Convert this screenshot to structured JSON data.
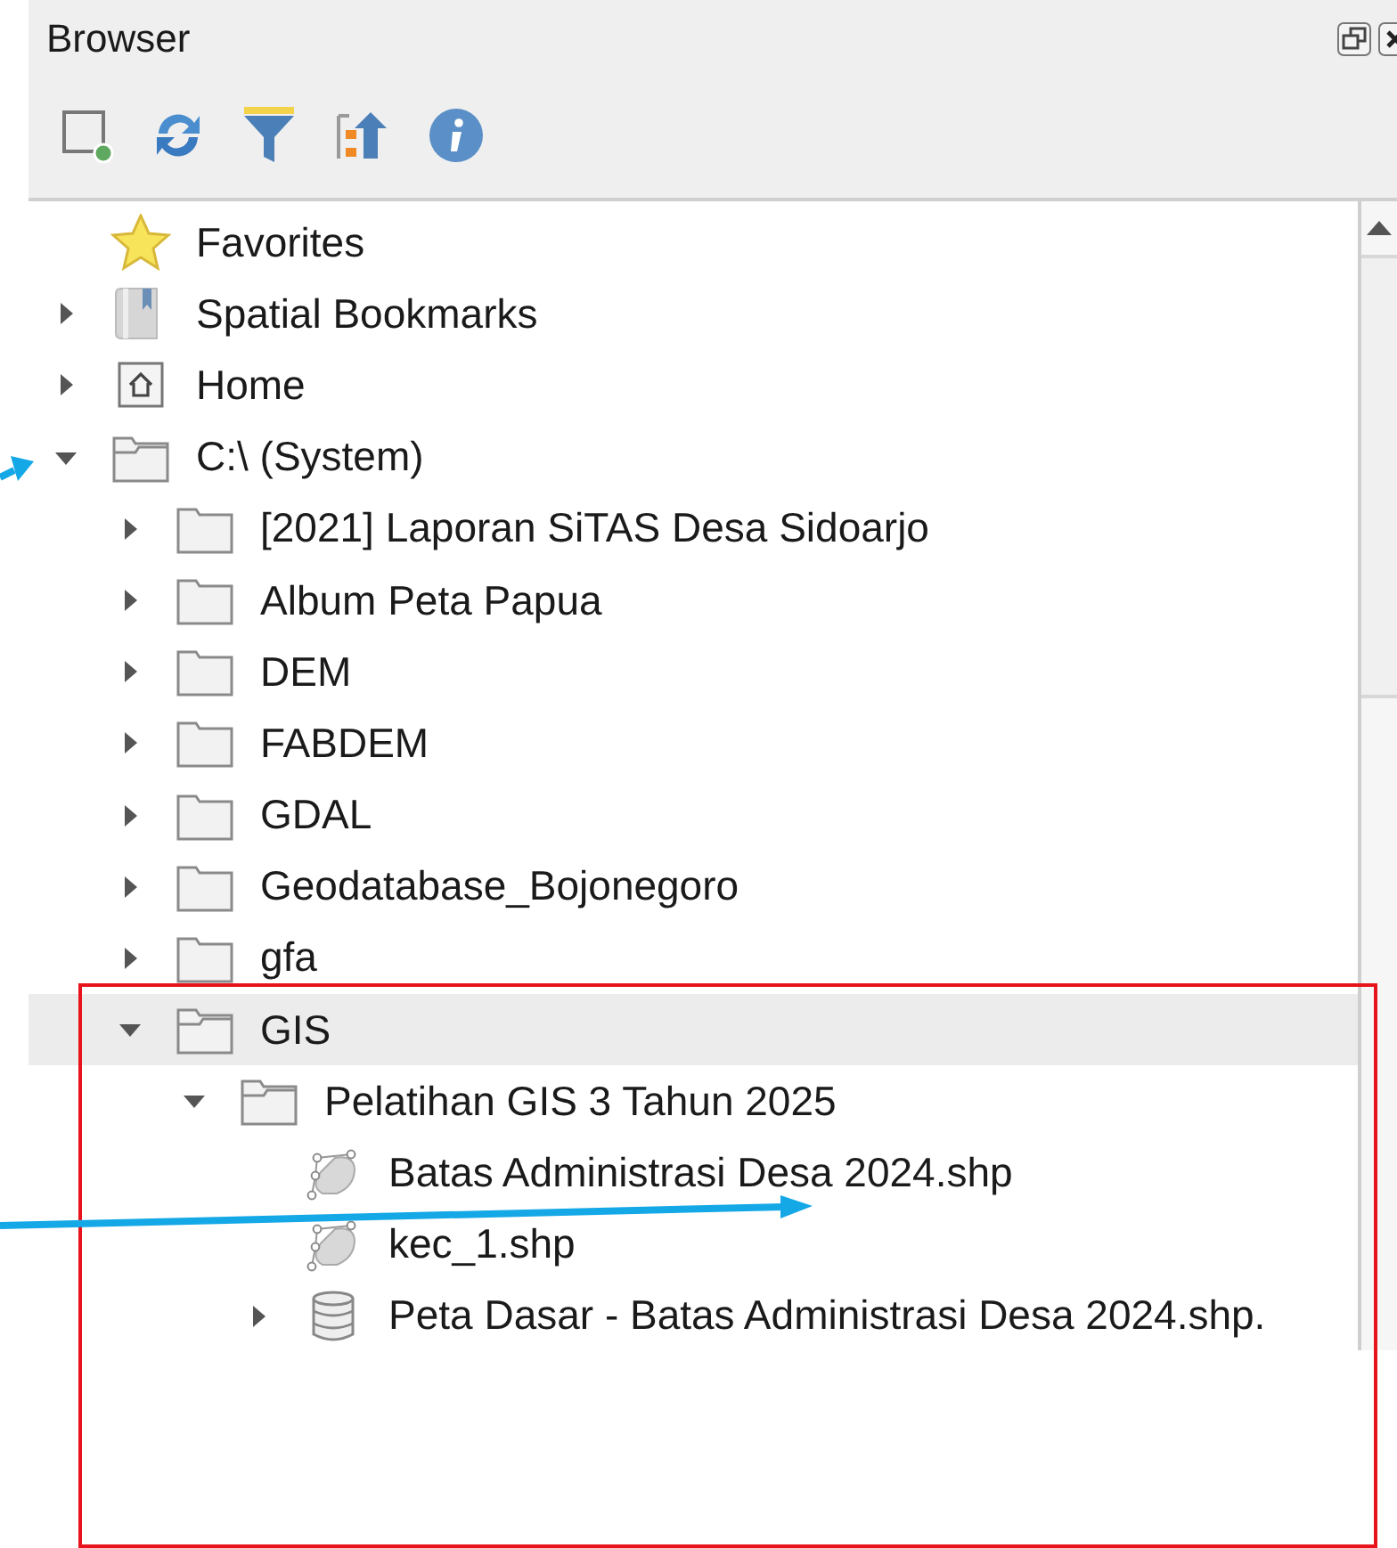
{
  "panel": {
    "title": "Browser"
  },
  "tree": [
    {
      "label": "Favorites",
      "kind": "favorites",
      "selected": false
    },
    {
      "label": "Spatial Bookmarks",
      "kind": "bookmarks",
      "expanded": false,
      "selected": false
    },
    {
      "label": "Home",
      "kind": "home",
      "expanded": false,
      "selected": false
    },
    {
      "label": "C:\\ (System)",
      "kind": "drive",
      "expanded": true,
      "selected": false,
      "children": [
        {
          "label": "[2021] Laporan SiTAS Desa Sidoarjo",
          "kind": "folder",
          "expanded": false,
          "selected": false
        },
        {
          "label": "Album Peta Papua",
          "kind": "folder",
          "expanded": false,
          "selected": false
        },
        {
          "label": "DEM",
          "kind": "folder",
          "expanded": false,
          "selected": false
        },
        {
          "label": "FABDEM",
          "kind": "folder",
          "expanded": false,
          "selected": false
        },
        {
          "label": "GDAL",
          "kind": "folder",
          "expanded": false,
          "selected": false
        },
        {
          "label": "Geodatabase_Bojonegoro",
          "kind": "folder",
          "expanded": false,
          "selected": false
        },
        {
          "label": "gfa",
          "kind": "folder",
          "expanded": false,
          "selected": false
        },
        {
          "label": "GIS",
          "kind": "folder",
          "expanded": true,
          "selected": true,
          "children": [
            {
              "label": "Pelatihan GIS 3 Tahun 2025",
              "kind": "folder",
              "expanded": true,
              "selected": false,
              "children": [
                {
                  "label": "Batas Administrasi Desa 2024.shp",
                  "kind": "vector",
                  "selected": false
                },
                {
                  "label": "kec_1.shp",
                  "kind": "vector",
                  "selected": false
                },
                {
                  "label": "Peta Dasar - Batas Administrasi Desa 2024.shp.",
                  "kind": "database",
                  "expanded": false,
                  "selected": false
                }
              ]
            }
          ]
        }
      ]
    }
  ]
}
